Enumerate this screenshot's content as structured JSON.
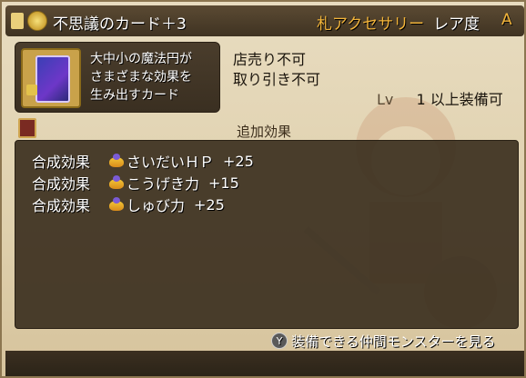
{
  "header": {
    "title": "不思議のカード＋3",
    "category": "札アクセサリー",
    "rarity_label": "レア度",
    "rarity_value": "A"
  },
  "item": {
    "description_lines": [
      "大中小の魔法円が",
      "さまざまな効果を",
      "生み出すカード"
    ]
  },
  "info": {
    "sell": "店売り不可",
    "trade": "取り引き不可",
    "level_label": "Lv",
    "level_value": "1",
    "level_suffix": "以上装備可"
  },
  "effects": {
    "title": "追加効果",
    "rows": [
      {
        "label": "合成効果",
        "name": "さいだいＨＰ",
        "value": "+25"
      },
      {
        "label": "合成効果",
        "name": "こうげき力",
        "value": "+15"
      },
      {
        "label": "合成効果",
        "name": "しゅび力",
        "value": "+25"
      }
    ]
  },
  "footer": {
    "button_glyph": "Y",
    "action_label": "装備できる仲間モンスターを見る"
  },
  "colors": {
    "accent": "#f2b43a",
    "panel": "#3c3020"
  }
}
